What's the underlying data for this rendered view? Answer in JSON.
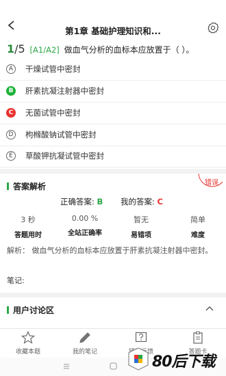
{
  "header": {
    "title": "第1章  基础护理知识和..."
  },
  "question": {
    "current": "1",
    "total": "5",
    "type": "[A1/A2]",
    "text": "做血气分析的血标本应放置于（  ）。"
  },
  "options": [
    {
      "letter": "A",
      "text": "干燥试管中密封",
      "state": "normal"
    },
    {
      "letter": "B",
      "text": "肝素抗凝注射器中密封",
      "state": "correct"
    },
    {
      "letter": "C",
      "text": "无菌试管中密封",
      "state": "wrong"
    },
    {
      "letter": "D",
      "text": "枸橼酸钠试管中密封",
      "state": "normal"
    },
    {
      "letter": "E",
      "text": "草酸钾抗凝试管中密封",
      "state": "normal"
    }
  ],
  "analysis": {
    "title": "答案解析",
    "stamp": "错误",
    "correct_label": "正确答案:",
    "correct_value": "B",
    "my_label": "我的答案:",
    "my_value": "C",
    "stats": [
      {
        "value": "3 秒",
        "label": "答题用时"
      },
      {
        "value": "0.00 %",
        "label": "全站正确率"
      },
      {
        "value": "暂无",
        "label": "易错项"
      },
      {
        "value": "简单",
        "label": "难度"
      }
    ],
    "explanation": "解析：   做血气分析的血标本应放置于肝素抗凝注射器中密封。",
    "note_label": "笔记:"
  },
  "discussion": {
    "title": "用户讨论区"
  },
  "tabs": [
    {
      "label": "收藏本题",
      "icon": "star-icon"
    },
    {
      "label": "我的笔记",
      "icon": "pen-icon"
    },
    {
      "label": "错题反馈",
      "icon": "feedback-icon"
    },
    {
      "label": "答题卡",
      "icon": "answer-card-icon"
    }
  ],
  "watermark": {
    "text": "80后下载"
  },
  "colors": {
    "green": "#2aa744",
    "red": "#e8322d",
    "correct_circle": "#1fb33a"
  }
}
